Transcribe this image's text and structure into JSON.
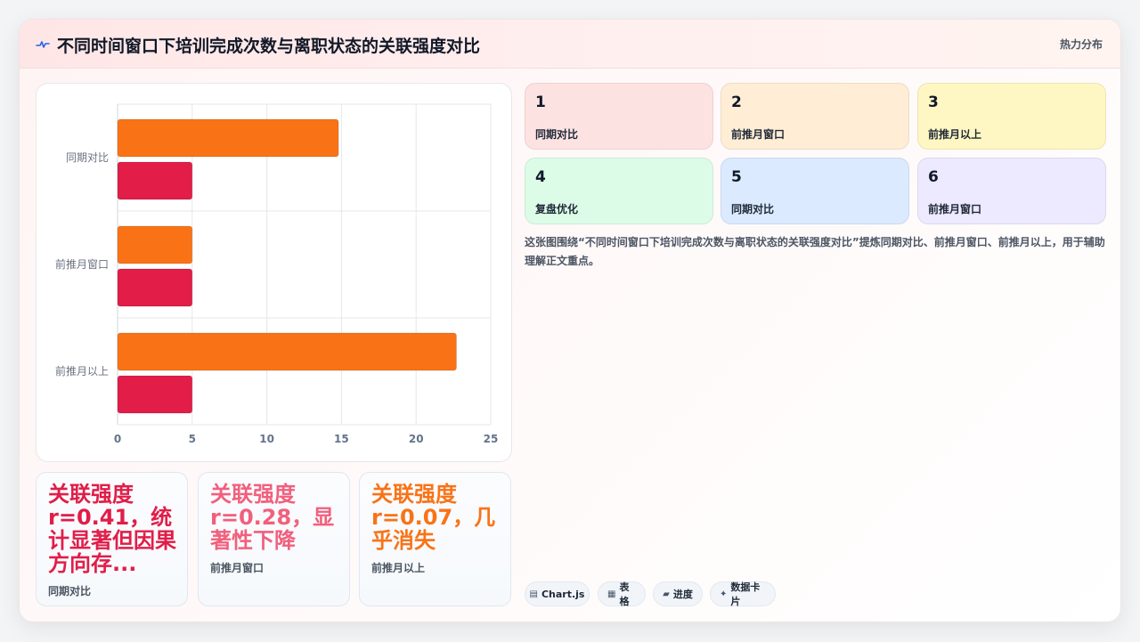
{
  "header": {
    "title": "不同时间窗口下培训完成次数与离职状态的关联强度对比",
    "tag": "热力分布",
    "logo_icon": "line-pulse-icon"
  },
  "chart_data": {
    "type": "bar",
    "orientation": "horizontal",
    "categories": [
      "同期对比",
      "前推月窗口",
      "前推月以上"
    ],
    "series": [
      {
        "color": "#f97316",
        "values": [
          14.8,
          5,
          22.7
        ]
      },
      {
        "color": "#e11d48",
        "values": [
          5,
          5,
          5
        ]
      }
    ],
    "xlim": [
      0,
      25
    ],
    "x_ticks": [
      "0",
      "5",
      "10",
      "15",
      "20",
      "25"
    ],
    "grid": true,
    "legend": "none"
  },
  "stats": [
    {
      "value": "关联强度r=0.41，统计显著但因果方向存...",
      "label": "同期对比",
      "color": "#e11d48"
    },
    {
      "value": "关联强度r=0.28，显著性下降",
      "label": "前推月窗口",
      "color": "#f25f7c"
    },
    {
      "value": "关联强度r=0.07，几乎消失",
      "label": "前推月以上",
      "color": "#f97316"
    }
  ],
  "kpi_cards": [
    {
      "num": "1",
      "label": "同期对比",
      "bg": "#fde2e2"
    },
    {
      "num": "2",
      "label": "前推月窗口",
      "bg": "#ffedd5"
    },
    {
      "num": "3",
      "label": "前推月以上",
      "bg": "#fef7c3"
    },
    {
      "num": "4",
      "label": "复盘优化",
      "bg": "#dcfce7"
    },
    {
      "num": "5",
      "label": "同期对比",
      "bg": "#dbeafe"
    },
    {
      "num": "6",
      "label": "前推月窗口",
      "bg": "#ede9fe"
    }
  ],
  "description": "这张图围绕“不同时间窗口下培训完成次数与离职状态的关联强度对比”提炼同期对比、前推月窗口、前推月以上，用于辅助理解正文重点。",
  "pills": [
    {
      "icon": "▤",
      "icon_name": "chart-icon",
      "label": "Chart.js"
    },
    {
      "icon": "▦",
      "icon_name": "table-icon",
      "label": "表格"
    },
    {
      "icon": "▰",
      "icon_name": "progress-icon",
      "label": "进度"
    },
    {
      "icon": "✦",
      "icon_name": "sparkle-icon",
      "label": "数据卡片"
    }
  ]
}
